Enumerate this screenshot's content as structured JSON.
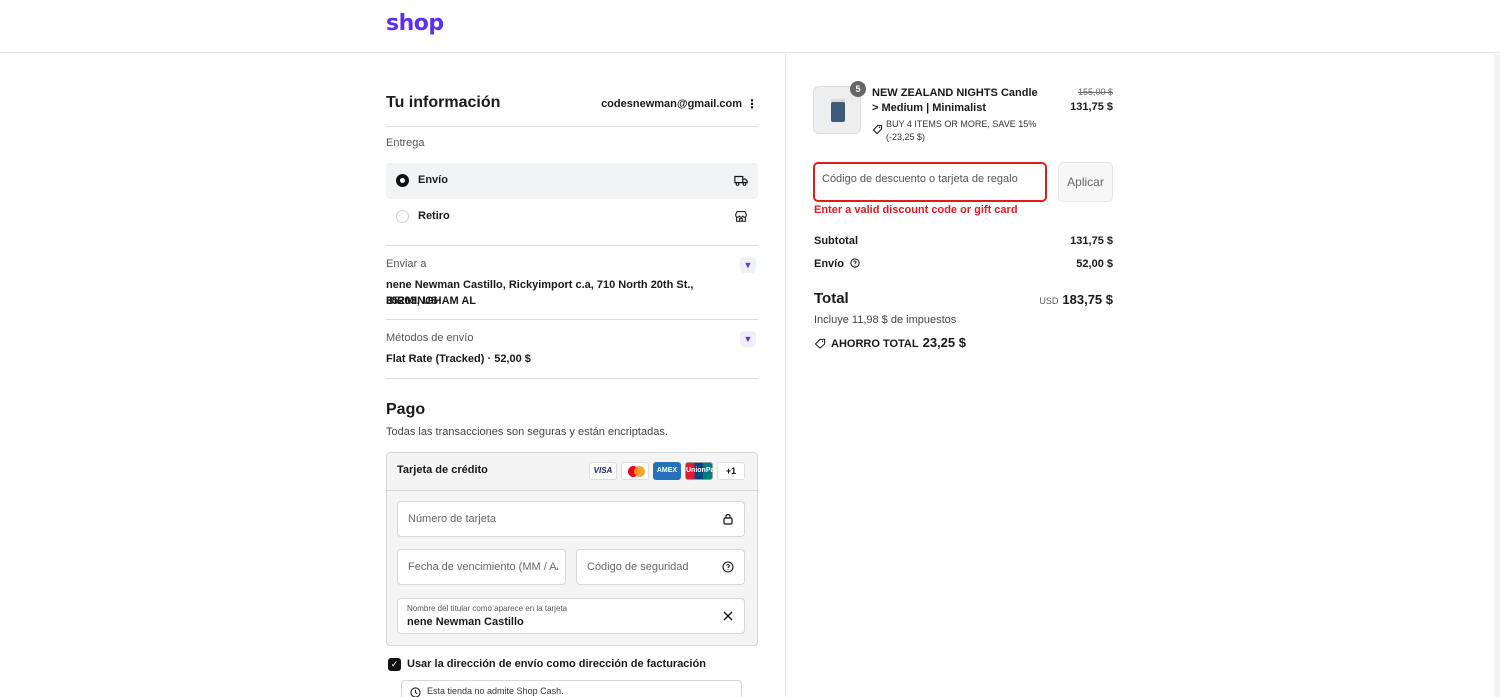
{
  "brand": {
    "logo_text": "shop",
    "color": "#5a31f4"
  },
  "info": {
    "title": "Tu información",
    "email": "codesnewman@gmail.com",
    "menu_glyph": "⋮"
  },
  "delivery": {
    "label": "Entrega",
    "options": [
      {
        "label": "Envío",
        "selected": true,
        "icon": "truck-icon"
      },
      {
        "label": "Retiro",
        "selected": false,
        "icon": "store-icon"
      }
    ]
  },
  "ship_to": {
    "label": "Enviar a",
    "address_line1": "nene Newman Castillo, Rickyimport c.a, 710 North 20th St., BIRMINGHAM AL",
    "address_line2": "35203, US"
  },
  "shipping_method": {
    "label": "Métodos de envío",
    "value": "Flat Rate (Tracked) · 52,00 $"
  },
  "payment": {
    "title": "Pago",
    "subtitle": "Todas las transacciones son seguras y están encriptadas.",
    "card_title": "Tarjeta de crédito",
    "brands": [
      "VISA",
      "AMEX",
      "UnionPay",
      "+1"
    ],
    "card_number_placeholder": "Número de tarjeta",
    "expiry_placeholder": "Fecha de vencimiento (MM / AA)",
    "cvv_placeholder": "Código de seguridad",
    "name_label": "Nombre del titular como aparece en la tarjeta",
    "name_value": "nene Newman Castillo",
    "billing_same_label": "Usar la dirección de envío como dirección de facturación",
    "billing_same_checked": true,
    "notice": "Esta tienda no admite Shop Cash."
  },
  "order": {
    "quantity": "5",
    "product_name": "NEW ZEALAND NIGHTS Candle > Medium | Minimalist",
    "discount_text": "BUY 4 ITEMS OR MORE, SAVE 15% (-23,25 $)",
    "price_original": "155,00 $",
    "price_final": "131,75 $",
    "discount_placeholder": "Código de descuento o tarjeta de regalo",
    "apply_label": "Aplicar",
    "error_text": "Enter a valid discount code or gift card",
    "error_color": "#dd1d1d",
    "subtotal_label": "Subtotal",
    "subtotal_value": "131,75 $",
    "shipping_label": "Envío",
    "shipping_value": "52,00 $",
    "total_label": "Total",
    "currency": "USD",
    "total_value": "183,75 $",
    "tax_text": "Incluye 11,98 $ de impuestos",
    "savings_label": "AHORRO TOTAL",
    "savings_value": "23,25 $"
  }
}
